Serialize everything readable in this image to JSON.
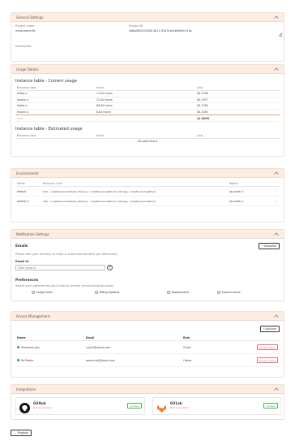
{
  "general": {
    "title": "General Settings",
    "project_name_label": "Project name",
    "project_name_value": "neat-grace-fd",
    "project_id_label": "Project ID",
    "project_id_value": "cb8a4305-0428-4011-93c3-ee1bf6a5c21bc",
    "description_label": "Description"
  },
  "usage": {
    "title": "Usage Details",
    "current_title": "Instance table - Current usage",
    "current_headers": [
      "Resource type",
      "Hours",
      "Cost"
    ],
    "current_rows": [
      [
        "feeba-a",
        "11.00 hours",
        "$0.1198"
      ],
      [
        "moore-a",
        "22.00 hours",
        "$0.1927"
      ],
      [
        "feeba-a",
        "66.00 hours",
        "$0.1784"
      ],
      [
        "moore-a",
        "6.00 hours",
        "$0.1187"
      ]
    ],
    "cost_label": "Cost",
    "cost_total": "$1.0096",
    "estimated_title": "Instance table - Estimated usage",
    "estimated_headers": [
      "Resource type",
      "Hours",
      "Cost"
    ],
    "no_data": "No data found"
  },
  "environments": {
    "title": "Environments",
    "headers": [
      "Name",
      "Resource Limit",
      "Region"
    ],
    "rows": [
      {
        "name": "default",
        "limits": "CPU : undefined,Undefined | Memory : undefined,Undefined | Storage : undefined,Undefined",
        "region": "ap-south-1"
      },
      {
        "name": "default-2",
        "limits": "CPU : undefined,Undefined | Memory : undefined,Undefined | Storage : undefined,Undefined",
        "region": "ap-south-1"
      }
    ]
  },
  "notifications": {
    "title": "Notification Settings",
    "subscribe_label": "+ Subscribe",
    "emails_title": "Emails",
    "emails_desc": "Please add your email(s) to help us communicate with you effectively.",
    "email_id_label": "Email id",
    "email_placeholder": "Enter email id",
    "add_icon_glyph": "+",
    "preferences_title": "Preferences",
    "preferences_desc": "Select your preferences you'd like to receive communication about.",
    "options": [
      "Usage limits",
      "Billing Updates",
      "Deployments",
      "System errors"
    ]
  },
  "access": {
    "title": "Access Management",
    "add_user_label": "+ Add user",
    "headers": [
      "Name",
      "Email",
      "Role"
    ],
    "rows": [
      {
        "name": "Preetham Jain",
        "email": "p.jain@yahoo.com",
        "role": "Guest",
        "action": "Revoke access"
      },
      {
        "name": "Ed Peeler",
        "email": "peeler.ed@gmail.com",
        "role": "Owner",
        "action": "Revoke access"
      }
    ]
  },
  "integrations": {
    "title": "Integrations",
    "items": [
      {
        "name": "GitHub",
        "status": "Not Connected",
        "action": "Connect"
      },
      {
        "name": "GitLab",
        "status": "Not Connected",
        "action": "Connect"
      }
    ]
  },
  "footer": {
    "back_label": "← Projects"
  },
  "colors": {
    "header_bg": "#fdece2",
    "accent": "#e8a070",
    "danger": "#e57373",
    "success": "#4caf50"
  }
}
